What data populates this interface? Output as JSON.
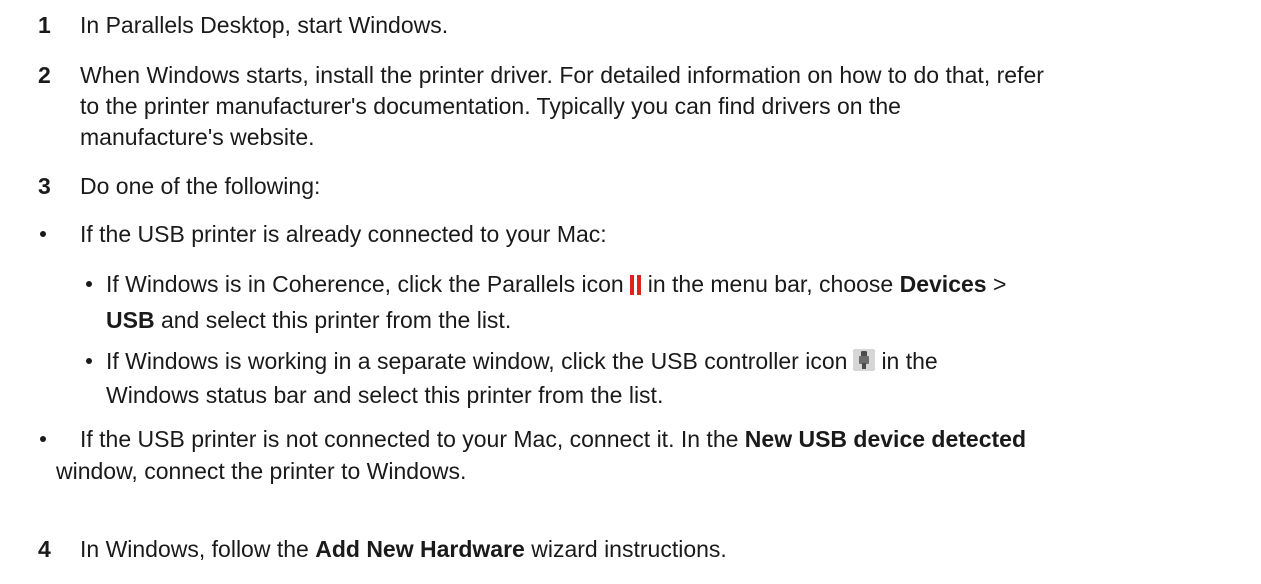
{
  "steps": {
    "s1": {
      "num": "1",
      "text": "In Parallels Desktop, start Windows."
    },
    "s2": {
      "num": "2",
      "line1": "When Windows starts, install the printer driver. For detailed information on how to do that, refer",
      "line2": "to the printer manufacturer's documentation. Typically you can find drivers on the",
      "line3": "manufacture's website."
    },
    "s3": {
      "num": "3",
      "text": "Do one of the following:"
    },
    "s4": {
      "num": "4",
      "pre": "In Windows, follow the",
      "bold": "Add New Hardware",
      "post": "wizard instructions."
    }
  },
  "bullets": {
    "b1": {
      "text": "If the USB printer is already connected to your Mac:"
    },
    "b1a": {
      "pre": "If Windows is in Coherence, click the Parallels icon",
      "mid": "in the menu bar, choose",
      "bold1": "Devices",
      "sep": ">",
      "bold2": "USB",
      "post": "and select this printer from the list."
    },
    "b1b": {
      "pre": "If Windows is working in a separate window, click the USB controller icon",
      "mid": "in the",
      "line2": "Windows status bar and select this printer from the list."
    },
    "b2": {
      "pre": "If the USB printer is not connected to your Mac, connect it. In the",
      "bold": "New USB device detected",
      "line2": "window, connect the printer to Windows."
    }
  },
  "icons": {
    "parallels": {
      "name": "parallels-icon",
      "color": "#e0231b"
    },
    "usb": {
      "name": "usb-controller-icon",
      "color": "#6b6b6b"
    }
  }
}
